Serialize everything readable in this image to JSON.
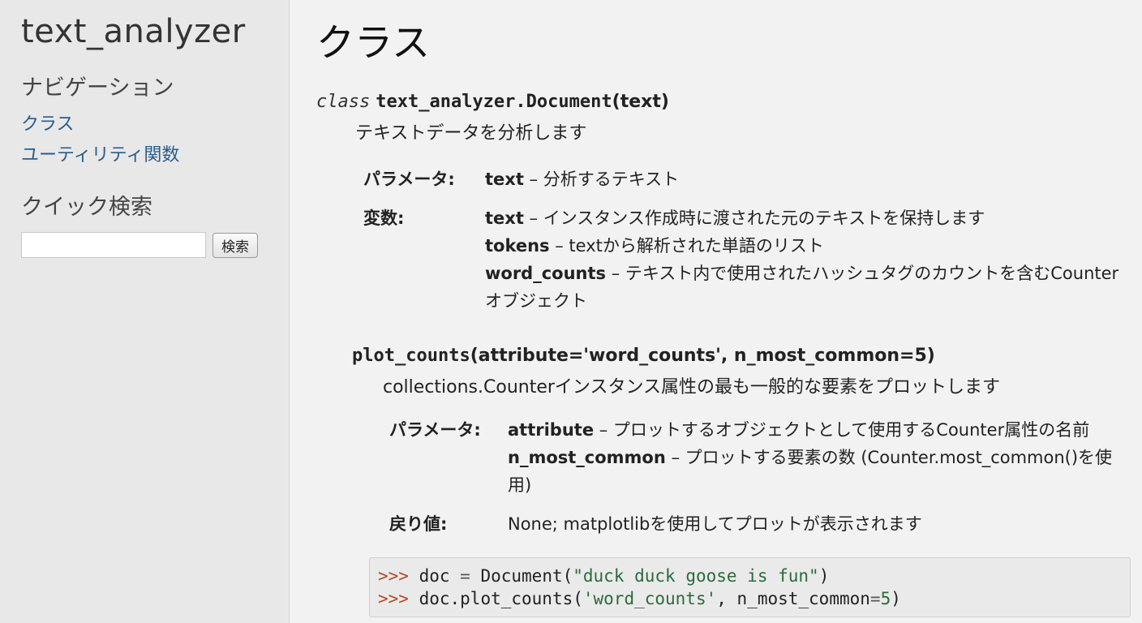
{
  "sidebar": {
    "project_title": "text_analyzer",
    "nav_heading": "ナビゲーション",
    "nav_items": [
      {
        "label": "クラス"
      },
      {
        "label": "ユーティリティ関数"
      }
    ],
    "search_heading": "クイック検索",
    "search_input_value": "",
    "search_button": "検索"
  },
  "main": {
    "title": "クラス",
    "class_sig": {
      "keyword": "class",
      "name": "text_analyzer.Document",
      "args": "(text)"
    },
    "class_desc": "テキストデータを分析します",
    "class_fields": {
      "params_label": "パラメータ:",
      "params": [
        {
          "name": "text",
          "desc": " – 分析するテキスト"
        }
      ],
      "vars_label": "変数:",
      "vars": [
        {
          "name": "text",
          "desc": " – インスタンス作成時に渡された元のテキストを保持します"
        },
        {
          "name": "tokens",
          "desc": " – textから解析された単語のリスト"
        },
        {
          "name": "word_counts",
          "desc": " – テキスト内で使用されたハッシュタグのカウントを含むCounterオブジェクト"
        }
      ]
    },
    "method": {
      "name": "plot_counts",
      "args": "(attribute='word_counts', n_most_common=5)",
      "desc": "collections.Counterインスタンス属性の最も一般的な要素をプロットします",
      "params_label": "パラメータ:",
      "params": [
        {
          "name": "attribute",
          "desc": " – プロットするオブジェクトとして使用するCounter属性の名前"
        },
        {
          "name": "n_most_common",
          "desc": " – プロットする要素の数 (Counter.most_common()を使用)"
        }
      ],
      "returns_label": "戻り値:",
      "returns": "None; matplotlibを使用してプロットが表示されます"
    },
    "code": {
      "prompt": ">>>",
      "line1": {
        "pre": " doc ",
        "op": "=",
        "call": " Document(",
        "str": "\"duck duck goose is fun\"",
        "post": ")"
      },
      "line2": {
        "pre": " doc.plot_counts(",
        "str": "'word_counts'",
        "mid": ", n_most_common",
        "op": "=",
        "num": "5",
        "post": ")"
      }
    }
  }
}
